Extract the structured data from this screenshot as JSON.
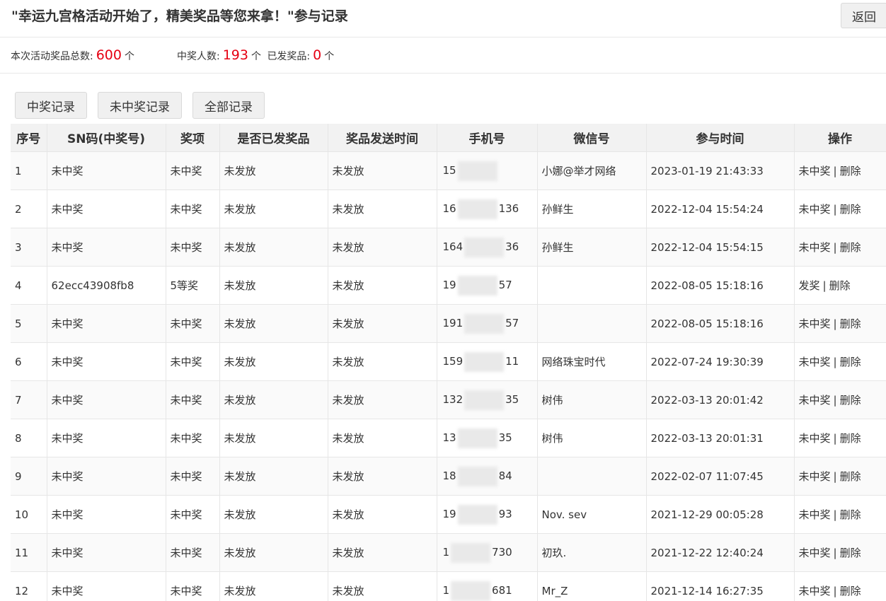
{
  "header": {
    "title": "\"幸运九宫格活动开始了，精美奖品等您来拿！\"参与记录",
    "back_label": "返回"
  },
  "stats": {
    "total_label": "本次活动奖品总数:",
    "total_value": "600",
    "total_unit": "个",
    "winners_label": "中奖人数:",
    "winners_value": "193",
    "winners_unit": "个",
    "sent_label": "已发奖品:",
    "sent_value": "0",
    "sent_unit": "个"
  },
  "filters": [
    {
      "label": "中奖记录"
    },
    {
      "label": "未中奖记录"
    },
    {
      "label": "全部记录"
    }
  ],
  "table": {
    "headers": [
      "序号",
      "SN码(中奖号)",
      "奖项",
      "是否已发奖品",
      "奖品发送时间",
      "手机号",
      "微信号",
      "参与时间",
      "操作"
    ],
    "op_sep": "|",
    "rows": [
      {
        "no": "1",
        "sn": "未中奖",
        "prize": "未中奖",
        "sent": "未发放",
        "sent_time": "未发放",
        "phone_prefix": "15",
        "phone_suffix": "",
        "wechat": "小娜@举才网络",
        "time": "2023-01-19 21:43:33",
        "op1": "未中奖",
        "op2": "删除"
      },
      {
        "no": "2",
        "sn": "未中奖",
        "prize": "未中奖",
        "sent": "未发放",
        "sent_time": "未发放",
        "phone_prefix": "16",
        "phone_suffix": "136",
        "wechat": "孙鲜生",
        "time": "2022-12-04 15:54:24",
        "op1": "未中奖",
        "op2": "删除"
      },
      {
        "no": "3",
        "sn": "未中奖",
        "prize": "未中奖",
        "sent": "未发放",
        "sent_time": "未发放",
        "phone_prefix": "164",
        "phone_suffix": "36",
        "wechat": "孙鲜生",
        "time": "2022-12-04 15:54:15",
        "op1": "未中奖",
        "op2": "删除"
      },
      {
        "no": "4",
        "sn": "62ecc43908fb8",
        "prize": "5等奖",
        "sent": "未发放",
        "sent_time": "未发放",
        "phone_prefix": "19",
        "phone_suffix": "57",
        "wechat": "",
        "time": "2022-08-05 15:18:16",
        "op1": "发奖",
        "op2": "删除"
      },
      {
        "no": "5",
        "sn": "未中奖",
        "prize": "未中奖",
        "sent": "未发放",
        "sent_time": "未发放",
        "phone_prefix": "191",
        "phone_suffix": "57",
        "wechat": "",
        "time": "2022-08-05 15:18:16",
        "op1": "未中奖",
        "op2": "删除"
      },
      {
        "no": "6",
        "sn": "未中奖",
        "prize": "未中奖",
        "sent": "未发放",
        "sent_time": "未发放",
        "phone_prefix": "159",
        "phone_suffix": "11",
        "wechat": "网络珠宝时代",
        "time": "2022-07-24 19:30:39",
        "op1": "未中奖",
        "op2": "删除"
      },
      {
        "no": "7",
        "sn": "未中奖",
        "prize": "未中奖",
        "sent": "未发放",
        "sent_time": "未发放",
        "phone_prefix": "132",
        "phone_suffix": "35",
        "wechat": "树伟",
        "time": "2022-03-13 20:01:42",
        "op1": "未中奖",
        "op2": "删除"
      },
      {
        "no": "8",
        "sn": "未中奖",
        "prize": "未中奖",
        "sent": "未发放",
        "sent_time": "未发放",
        "phone_prefix": "13",
        "phone_suffix": "35",
        "wechat": "树伟",
        "time": "2022-03-13 20:01:31",
        "op1": "未中奖",
        "op2": "删除"
      },
      {
        "no": "9",
        "sn": "未中奖",
        "prize": "未中奖",
        "sent": "未发放",
        "sent_time": "未发放",
        "phone_prefix": "18",
        "phone_suffix": "84",
        "wechat": "",
        "time": "2022-02-07 11:07:45",
        "op1": "未中奖",
        "op2": "删除"
      },
      {
        "no": "10",
        "sn": "未中奖",
        "prize": "未中奖",
        "sent": "未发放",
        "sent_time": "未发放",
        "phone_prefix": "19",
        "phone_suffix": "93",
        "wechat": "Nov. sev",
        "time": "2021-12-29 00:05:28",
        "op1": "未中奖",
        "op2": "删除"
      },
      {
        "no": "11",
        "sn": "未中奖",
        "prize": "未中奖",
        "sent": "未发放",
        "sent_time": "未发放",
        "phone_prefix": "1",
        "phone_suffix": "730",
        "wechat": "初玖.",
        "time": "2021-12-22 12:40:24",
        "op1": "未中奖",
        "op2": "删除"
      },
      {
        "no": "12",
        "sn": "未中奖",
        "prize": "未中奖",
        "sent": "未发放",
        "sent_time": "未发放",
        "phone_prefix": "1",
        "phone_suffix": "681",
        "wechat": "Mr_Z",
        "time": "2021-12-14 16:27:35",
        "op1": "未中奖",
        "op2": "删除"
      }
    ]
  }
}
